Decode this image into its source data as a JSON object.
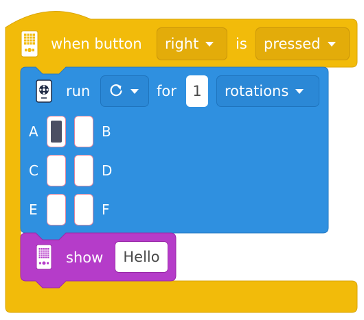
{
  "colors": {
    "event_block": "#f2bb0a",
    "motor_block": "#2f90e0",
    "display_block": "#b53cc9",
    "port_selected": "#4b4f63"
  },
  "event_block": {
    "icon": "hub-brick-icon",
    "label_when": "when button",
    "button_dropdown": "right",
    "label_is": "is",
    "state_dropdown": "pressed"
  },
  "motor_block": {
    "icon": "motor-icon",
    "label_run": "run",
    "direction_icon": "rotate-clockwise-icon",
    "label_for": "for",
    "amount": "1",
    "unit_dropdown": "rotations",
    "ports": [
      {
        "name": "A",
        "selected": true
      },
      {
        "name": "B",
        "selected": false
      },
      {
        "name": "C",
        "selected": false
      },
      {
        "name": "D",
        "selected": false
      },
      {
        "name": "E",
        "selected": false
      },
      {
        "name": "F",
        "selected": false
      }
    ]
  },
  "display_block": {
    "icon": "hub-display-icon",
    "label_show": "show",
    "text_value": "Hello"
  }
}
